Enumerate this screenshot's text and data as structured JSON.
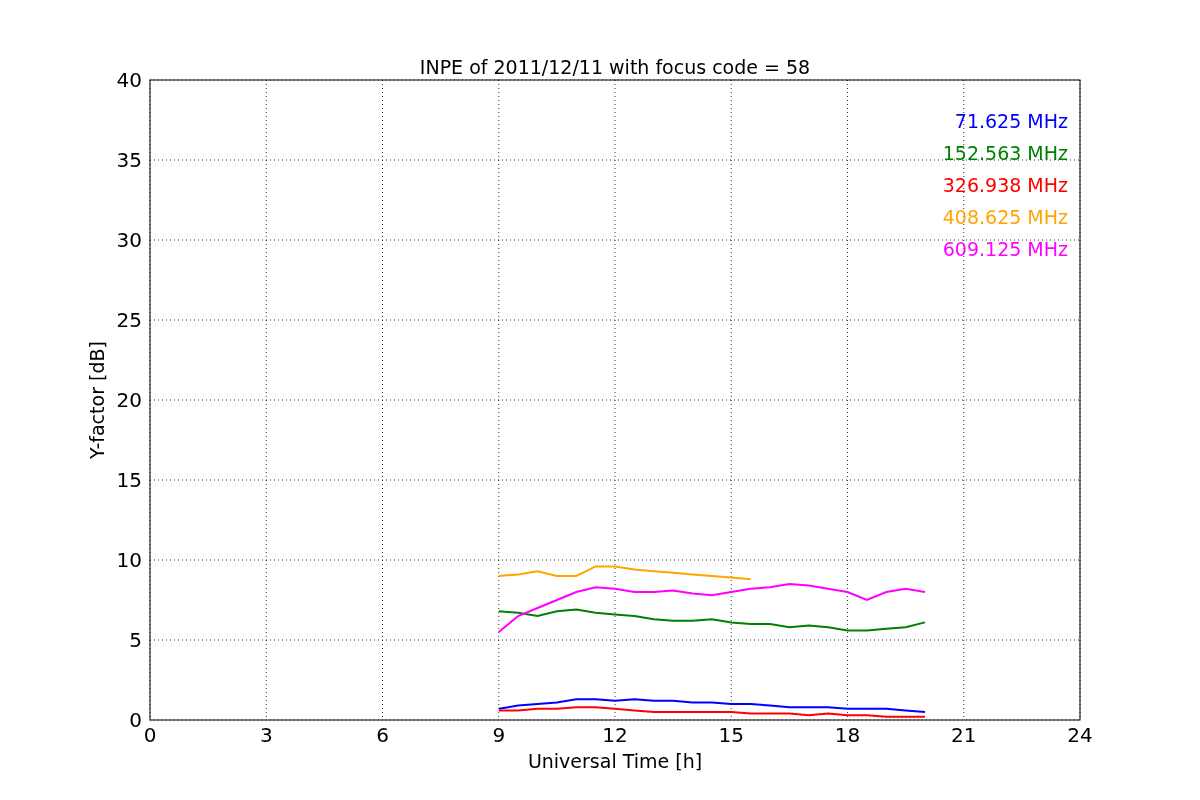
{
  "figure": {
    "chart_data": {
      "type": "line",
      "title": "INPE of 2011/12/11 with focus code = 58",
      "xlabel": "Universal Time [h]",
      "ylabel": "Y-factor [dB]",
      "x": [
        9,
        9.5,
        10,
        10.5,
        11,
        11.5,
        12,
        12.5,
        13,
        13.5,
        14,
        14.5,
        15,
        15.5,
        16,
        16.5,
        17,
        17.5,
        18,
        18.5,
        19,
        19.5,
        20
      ],
      "series": [
        {
          "name": "71.625 MHz",
          "color": "#0000ff",
          "values": [
            0.7,
            0.9,
            1.0,
            1.1,
            1.3,
            1.3,
            1.2,
            1.3,
            1.2,
            1.2,
            1.1,
            1.1,
            1.0,
            1.0,
            0.9,
            0.8,
            0.8,
            0.8,
            0.7,
            0.7,
            0.7,
            0.6,
            0.5
          ]
        },
        {
          "name": "152.563 MHz",
          "color": "#008000",
          "values": [
            6.8,
            6.7,
            6.5,
            6.8,
            6.9,
            6.7,
            6.6,
            6.5,
            6.3,
            6.2,
            6.2,
            6.3,
            6.1,
            6.0,
            6.0,
            5.8,
            5.9,
            5.8,
            5.6,
            5.6,
            5.7,
            5.8,
            6.1
          ]
        },
        {
          "name": "326.938 MHz",
          "color": "#ff0000",
          "values": [
            0.6,
            0.6,
            0.7,
            0.7,
            0.8,
            0.8,
            0.7,
            0.6,
            0.5,
            0.5,
            0.5,
            0.5,
            0.5,
            0.4,
            0.4,
            0.4,
            0.3,
            0.4,
            0.3,
            0.3,
            0.2,
            0.2,
            0.2
          ]
        },
        {
          "name": "408.625 MHz",
          "color": "#ffa500",
          "values": [
            9.0,
            9.1,
            9.3,
            9.0,
            9.0,
            9.6,
            9.6,
            9.4,
            9.3,
            9.2,
            9.1,
            9.0,
            8.9,
            8.8,
            null,
            null,
            null,
            null,
            null,
            null,
            null,
            null,
            null
          ]
        },
        {
          "name": "609.125 MHz",
          "color": "#ff00ff",
          "values": [
            5.5,
            6.5,
            7.0,
            7.5,
            8.0,
            8.3,
            8.2,
            8.0,
            8.0,
            8.1,
            7.9,
            7.8,
            8.0,
            8.2,
            8.3,
            8.5,
            8.4,
            8.2,
            8.0,
            7.5,
            8.0,
            8.2,
            8.0
          ]
        }
      ],
      "xlim": [
        0,
        24
      ],
      "ylim": [
        0,
        40
      ],
      "xticks": [
        0,
        3,
        6,
        9,
        12,
        15,
        18,
        21,
        24
      ],
      "yticks": [
        0,
        5,
        10,
        15,
        20,
        25,
        30,
        35,
        40
      ],
      "grid": true
    }
  }
}
